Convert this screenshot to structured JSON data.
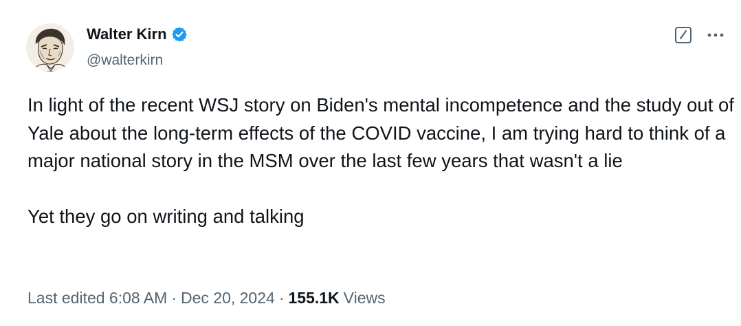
{
  "author": {
    "display_name": "Walter Kirn",
    "handle": "@walterkirn",
    "verified": true,
    "verified_color": "#1d9bf0"
  },
  "tweet": {
    "text": "In light of the recent WSJ story on Biden's mental incompetence and the study out of Yale about the long-term effects of the COVID vaccine, I am trying hard to think of a major national story in the MSM over the last few years that wasn't a lie\n\nYet they go on writing and talking"
  },
  "meta": {
    "edited_label": "Last edited 6:08 AM",
    "date": "Dec 20, 2024",
    "separator": "·",
    "views_count": "155.1K",
    "views_label": "Views"
  },
  "icons": {
    "avatar": "avatar-sketch-portrait",
    "verified": "verified-badge-icon",
    "edit": "edit-icon",
    "more": "more-icon"
  },
  "colors": {
    "text": "#0f1419",
    "secondary": "#536471",
    "accent": "#1d9bf0"
  }
}
